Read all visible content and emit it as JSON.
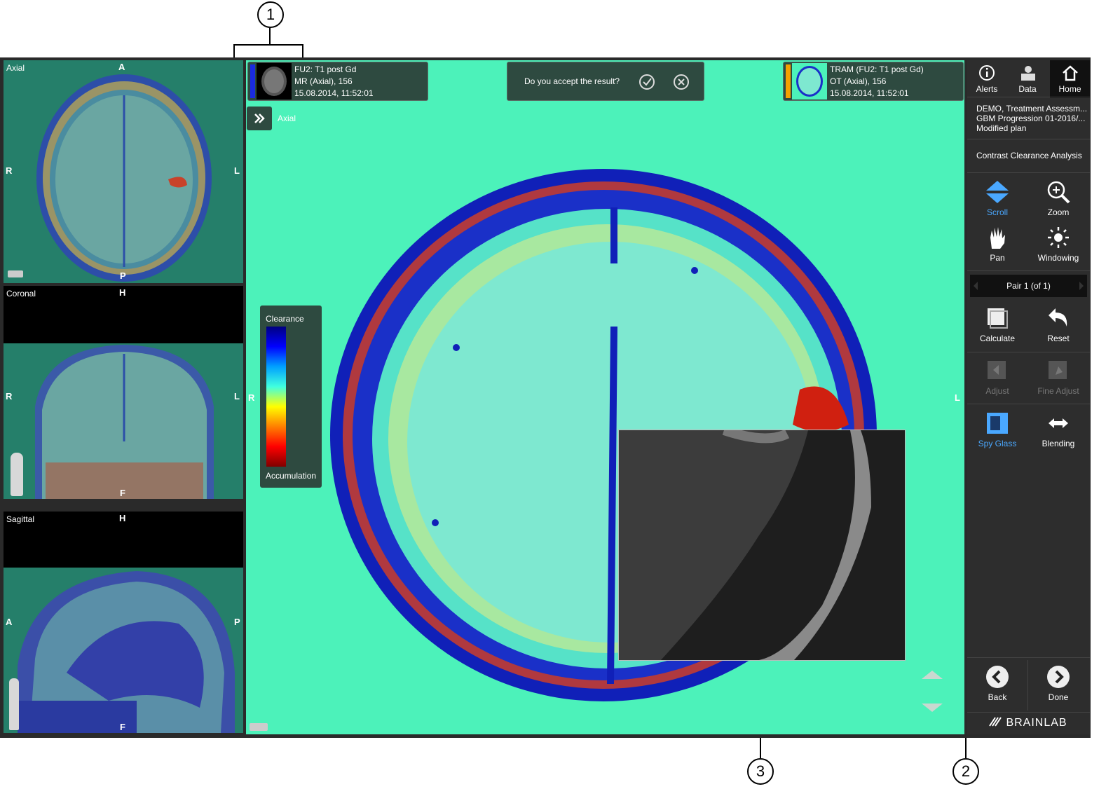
{
  "left_views": {
    "axial": {
      "label": "Axial",
      "top": "A",
      "bottom": "P",
      "left": "R",
      "right": "L"
    },
    "coronal": {
      "label": "Coronal",
      "top": "H",
      "bottom": "F",
      "left": "R",
      "right": "L"
    },
    "sagittal": {
      "label": "Sagittal",
      "top": "H",
      "bottom": "F",
      "left": "A",
      "right": "P"
    }
  },
  "main_view": {
    "series_info": {
      "line1": "FU2: T1 post Gd",
      "line2": "MR (Axial), 156",
      "line3": "15.08.2014, 11:52:01"
    },
    "overlay_info": {
      "line1": "TRAM (FU2: T1 post Gd)",
      "line2": "OT (Axial), 156",
      "line3": "15.08.2014, 11:52:01"
    },
    "accept_prompt": "Do you accept the result?",
    "view_label": "Axial",
    "orientation_left": "R",
    "orientation_right": "L",
    "legend": {
      "top_label": "Clearance",
      "bottom_label": "Accumulation"
    },
    "colors": {
      "background": "#4cf2ba",
      "overlay_accent": "#f5a000",
      "series_accent": "#1a2be0"
    }
  },
  "right_panel": {
    "top_nav": [
      {
        "label": "Alerts",
        "icon": "info-icon"
      },
      {
        "label": "Data",
        "icon": "data-icon"
      },
      {
        "label": "Home",
        "icon": "home-icon"
      }
    ],
    "patient": {
      "line1": "DEMO, Treatment Assessm...",
      "line2": "GBM Progression 01-2016/...",
      "line3": "Modified plan"
    },
    "analysis_title": "Contrast Clearance Analysis",
    "tools": {
      "scroll": "Scroll",
      "zoom": "Zoom",
      "pan": "Pan",
      "windowing": "Windowing",
      "calculate": "Calculate",
      "reset": "Reset",
      "adjust": "Adjust",
      "fine_adjust": "Fine Adjust",
      "spy_glass": "Spy Glass",
      "blending": "Blending"
    },
    "pair_selector": "Pair 1 (of 1)",
    "back": "Back",
    "done": "Done",
    "brand": "BRAINLAB"
  },
  "callouts": {
    "one": "1",
    "two": "2",
    "three": "3"
  }
}
